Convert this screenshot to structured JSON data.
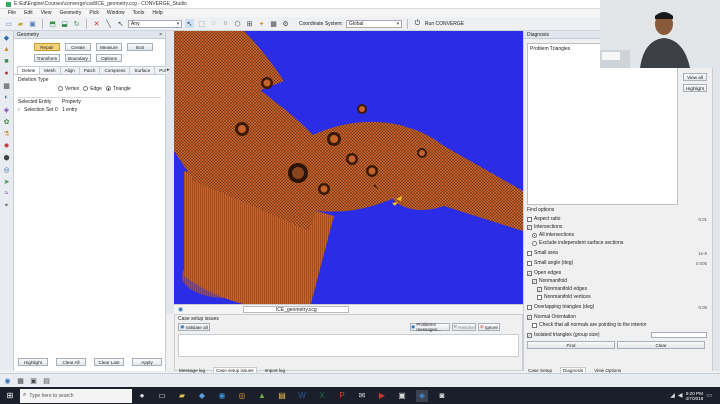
{
  "window": {
    "title": "E:\\Ed\\Engine\\Courses\\converge\\cad\\ICE_geometry.ccg - CONVERGE_Studio"
  },
  "menu": [
    "File",
    "Edit",
    "View",
    "Geometry",
    "Pick",
    "Window",
    "Tools",
    "Help"
  ],
  "toolbar": {
    "pick_mode": "Any",
    "coord_label": "Coordinate System:",
    "coord_value": "Global",
    "run_label": "Run CONVERGE"
  },
  "geometry_panel": {
    "title": "Geometry",
    "buttons": [
      "Repair",
      "Create",
      "Measure",
      "Boit",
      "Transform",
      "Boundary",
      "Options"
    ],
    "active_button": "Repair",
    "tabs": [
      "Delete",
      "Mesh",
      "Align",
      "Patch",
      "Compress",
      "Surface",
      "Polygo"
    ],
    "active_tab": "Delete",
    "deletion_type_label": "Deletion Type",
    "radios": [
      {
        "label": "Vertex",
        "checked": false
      },
      {
        "label": "Edge",
        "checked": false
      },
      {
        "label": "Triangle",
        "checked": true
      }
    ],
    "columns": [
      "Selected Entity",
      "Property"
    ],
    "rows": [
      {
        "entity": "Selection Set 0",
        "property": "1 entry"
      }
    ],
    "footer_buttons": [
      "Highlight",
      "Clear All",
      "Clear Last",
      "Apply"
    ]
  },
  "viewport": {
    "filename": "ICE_geometry.ccg"
  },
  "case_setup": {
    "title": "Case setup issues",
    "validate_button": "Validate all",
    "problems_button": "Problems messages...",
    "fix_button": "Resolve",
    "ignore_button": "Ignore",
    "bottom_tabs": [
      "Message log",
      "Case setup issues",
      "Import log"
    ],
    "active_tab": "Case setup issues"
  },
  "diagnosis": {
    "title": "Diagnosis",
    "list_item": "Problem Triangles",
    "view_all": "View all",
    "highlight": "Highlight",
    "find_options": "Find options",
    "options": [
      {
        "label": "Aspect ratio",
        "checked": false,
        "value": "0.01"
      },
      {
        "label": "Intersections",
        "checked": true,
        "value": ""
      },
      {
        "label": "All intersections",
        "radio": true,
        "checked": true
      },
      {
        "label": "Exclude independent surface sections",
        "radio": true,
        "checked": false
      },
      {
        "label": "Small area",
        "checked": false,
        "value": "1e-8"
      },
      {
        "label": "Small angle (deg)",
        "checked": false,
        "value": "0.005"
      },
      {
        "label": "Open edges",
        "checked": true,
        "value": ""
      },
      {
        "label": "Nonmanifold",
        "checked": true,
        "indent": true,
        "value": ""
      },
      {
        "label": "Nonmanifold edges",
        "checked": true,
        "indent": true,
        "value": ""
      },
      {
        "label": "Nonmanifold vertices",
        "checked": false,
        "indent": true,
        "value": ""
      },
      {
        "label": "Overlapping triangles (deg)",
        "checked": false,
        "value": "0.05"
      },
      {
        "label": "Normal Orientation",
        "checked": true,
        "value": ""
      },
      {
        "label": "Check that all normals are pointing to the interior",
        "checked": false,
        "indent": true,
        "value": ""
      },
      {
        "label": "Isolated triangles (group size)",
        "checked": true,
        "value": ""
      }
    ],
    "find_button": "Find",
    "clear_button": "Clear",
    "bottom_tabs": [
      "Case Setup",
      "Diagnosis",
      "View Options"
    ],
    "active_tab": "Diagnosis"
  },
  "taskbar": {
    "search_placeholder": "Type here to search",
    "time": "6:20 PM",
    "date": "4/7/2018"
  },
  "colors": {
    "accent": "#f3d27a",
    "viewport_bg": "#2b2ce6",
    "mesh": "#c8622b",
    "taskbar": "#1b1f2a"
  }
}
